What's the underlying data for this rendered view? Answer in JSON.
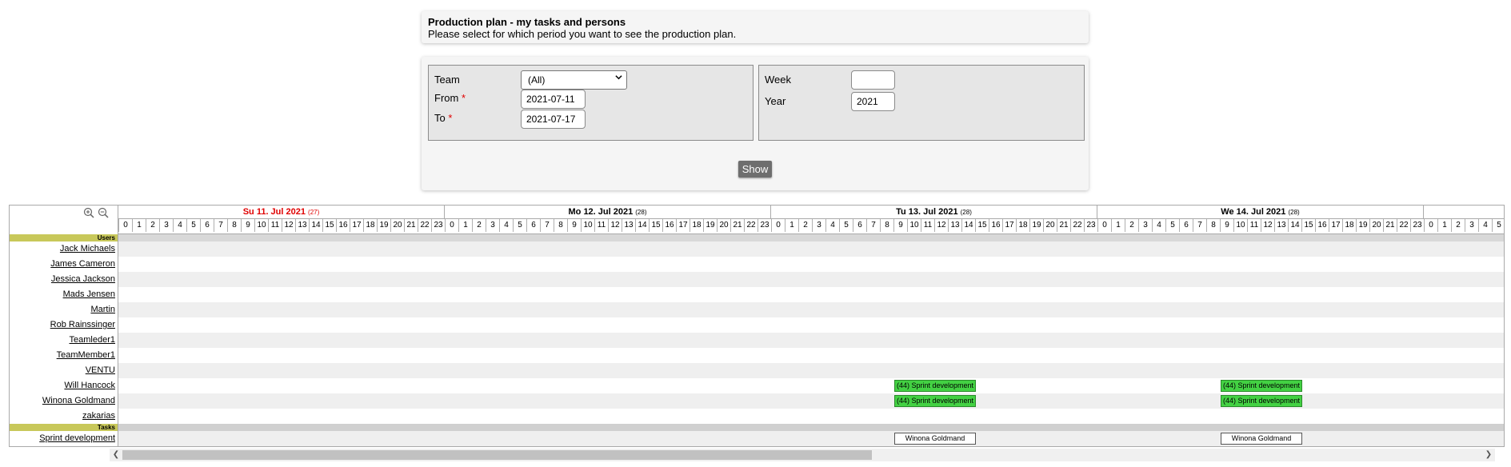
{
  "header": {
    "title": "Production plan - my tasks and persons",
    "subtitle": "Please select for which period you want to see the production plan."
  },
  "filters": {
    "team_label": "Team",
    "team_value": "(All)",
    "from_label": "From",
    "from_value": "2021-07-11",
    "to_label": "To",
    "to_value": "2021-07-17",
    "required_mark": "*",
    "week_label": "Week",
    "week_value": "",
    "year_label": "Year",
    "year_value": "2021",
    "show_label": "Show"
  },
  "gantt": {
    "days": [
      {
        "label": "Su 11. Jul 2021",
        "week": "(27)",
        "today": true
      },
      {
        "label": "Mo 12. Jul 2021",
        "week": "(28)",
        "today": false
      },
      {
        "label": "Tu 13. Jul 2021",
        "week": "(28)",
        "today": false
      },
      {
        "label": "We 14. Jul 2021",
        "week": "(28)",
        "today": false
      }
    ],
    "hours_per_day": 24,
    "users_section": "Users",
    "tasks_section": "Tasks",
    "users": [
      "Jack Michaels",
      "James Cameron",
      "Jessica Jackson",
      "Mads Jensen",
      "Martin",
      "Rob Rainssinger",
      "Teamleder1",
      "TeamMember1",
      "VENTU",
      "Will Hancock",
      "Winona Goldmand",
      "zakarias"
    ],
    "tasks": [
      "Sprint development"
    ],
    "task_bar_label": "(44) Sprint development",
    "person_bar_label": "Winona Goldmand",
    "colors": {
      "task_bar": "#43d143",
      "section_bar": "#c8c85a",
      "today": "#e00000"
    }
  }
}
